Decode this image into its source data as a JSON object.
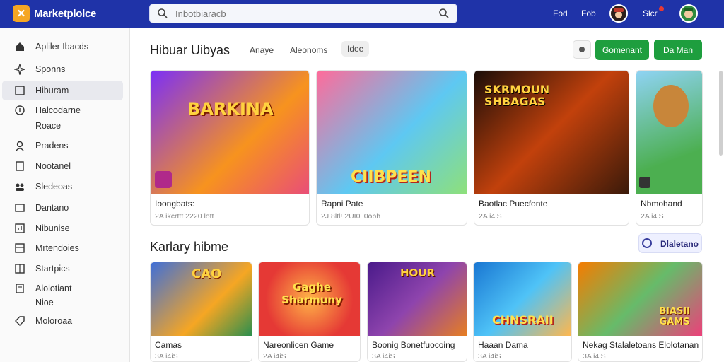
{
  "header": {
    "logo_glyph": "✕",
    "brand": "Marketplolce",
    "search_placeholder": "Inbotbiaracb",
    "links": [
      "Fod",
      "Fob",
      "Slcr"
    ]
  },
  "sidebar": {
    "items": [
      {
        "label": "Apliler Ibacds",
        "icon": "home-icon"
      },
      {
        "label": "Sponns",
        "icon": "sparkle-icon"
      },
      {
        "label": "Hiburam",
        "icon": "bookmark-icon",
        "active": true
      },
      {
        "label": "Halcodarne",
        "icon": "info-icon"
      },
      {
        "label": "Roace",
        "icon": ""
      },
      {
        "label": "Pradens",
        "icon": "person-icon"
      },
      {
        "label": "Nootanel",
        "icon": "bookmark-icon"
      },
      {
        "label": "Sledeoas",
        "icon": "people-icon"
      },
      {
        "label": "Dantano",
        "icon": "folder-icon"
      },
      {
        "label": "Nibunise",
        "icon": "chart-icon"
      },
      {
        "label": "Mrtendoies",
        "icon": "table-icon"
      },
      {
        "label": "Startpics",
        "icon": "grid-icon"
      },
      {
        "label": "Alolotiant",
        "icon": "document-icon"
      },
      {
        "label": "Nioe",
        "icon": ""
      },
      {
        "label": "Moloroaa",
        "icon": "tag-icon"
      }
    ]
  },
  "section1": {
    "title": "Hibuar Uibyas",
    "filters": [
      "Anaye",
      "Aleonoms",
      "Idee"
    ],
    "buttons": [
      "Gomenant",
      "Da Man"
    ],
    "cards": [
      {
        "title": "Ioongbats:",
        "meta": "2A ikcrttt 2220 lott",
        "art": "BARKINA"
      },
      {
        "title": "Rapni Pate",
        "meta": "2J 8ltl! 2UI0 l0obh",
        "art": "CIIBPEEN"
      },
      {
        "title": "Baotlac Puecfonte",
        "meta": "2A i4iS",
        "art": "SKRMOUN SHBAGAS"
      },
      {
        "title": "Nbmohand",
        "meta": "2A i4iS",
        "art": ""
      }
    ]
  },
  "section2": {
    "title": "Karlary hibme",
    "button": "Dlaletano",
    "cards": [
      {
        "title": "Camas",
        "meta": "3A i4iS",
        "art": "CAO"
      },
      {
        "title": "Nareonlicen Game",
        "meta": "2A i4iS",
        "art": "Gaghe Sharmuny"
      },
      {
        "title": "Boonig Bonetfuocoing",
        "meta": "3A i4iS",
        "art": "HOUR"
      },
      {
        "title": "Haaan Dama",
        "meta": "3A i4iS",
        "art": "CHNSRAII"
      },
      {
        "title": "Nekag Stalaletoans Elolotanan",
        "meta": "3A i4iS",
        "art": "BIASII GAMS"
      }
    ]
  },
  "colors": {
    "topbar": "#1f33a8",
    "accent_green": "#1e9e3e",
    "logo": "#f5a623"
  }
}
